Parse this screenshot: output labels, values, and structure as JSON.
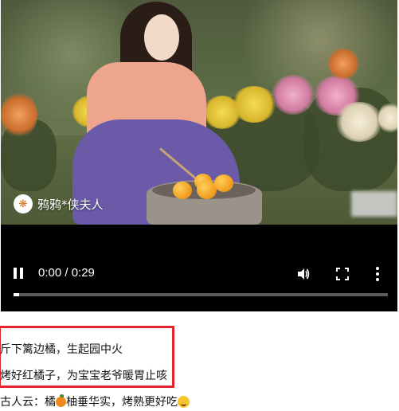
{
  "video": {
    "watermark_text": "鸦鸦*侠夫人",
    "time_display": "0:00 / 0:29",
    "progress_fraction": 0.0,
    "icons": [
      "pause-icon",
      "volume-icon",
      "fullscreen-icon",
      "more-options-icon"
    ]
  },
  "captions": {
    "line1": "斤下篱边橘，生起园中火",
    "line2": "烤好红橘子，为宝宝老爷暖胃止咳",
    "line3_a": "古人云：橘",
    "line3_b": "柚垂华实，烤熟更好吃"
  },
  "colors": {
    "highlight_border": "#e2262b",
    "player_bg": "#000000"
  }
}
